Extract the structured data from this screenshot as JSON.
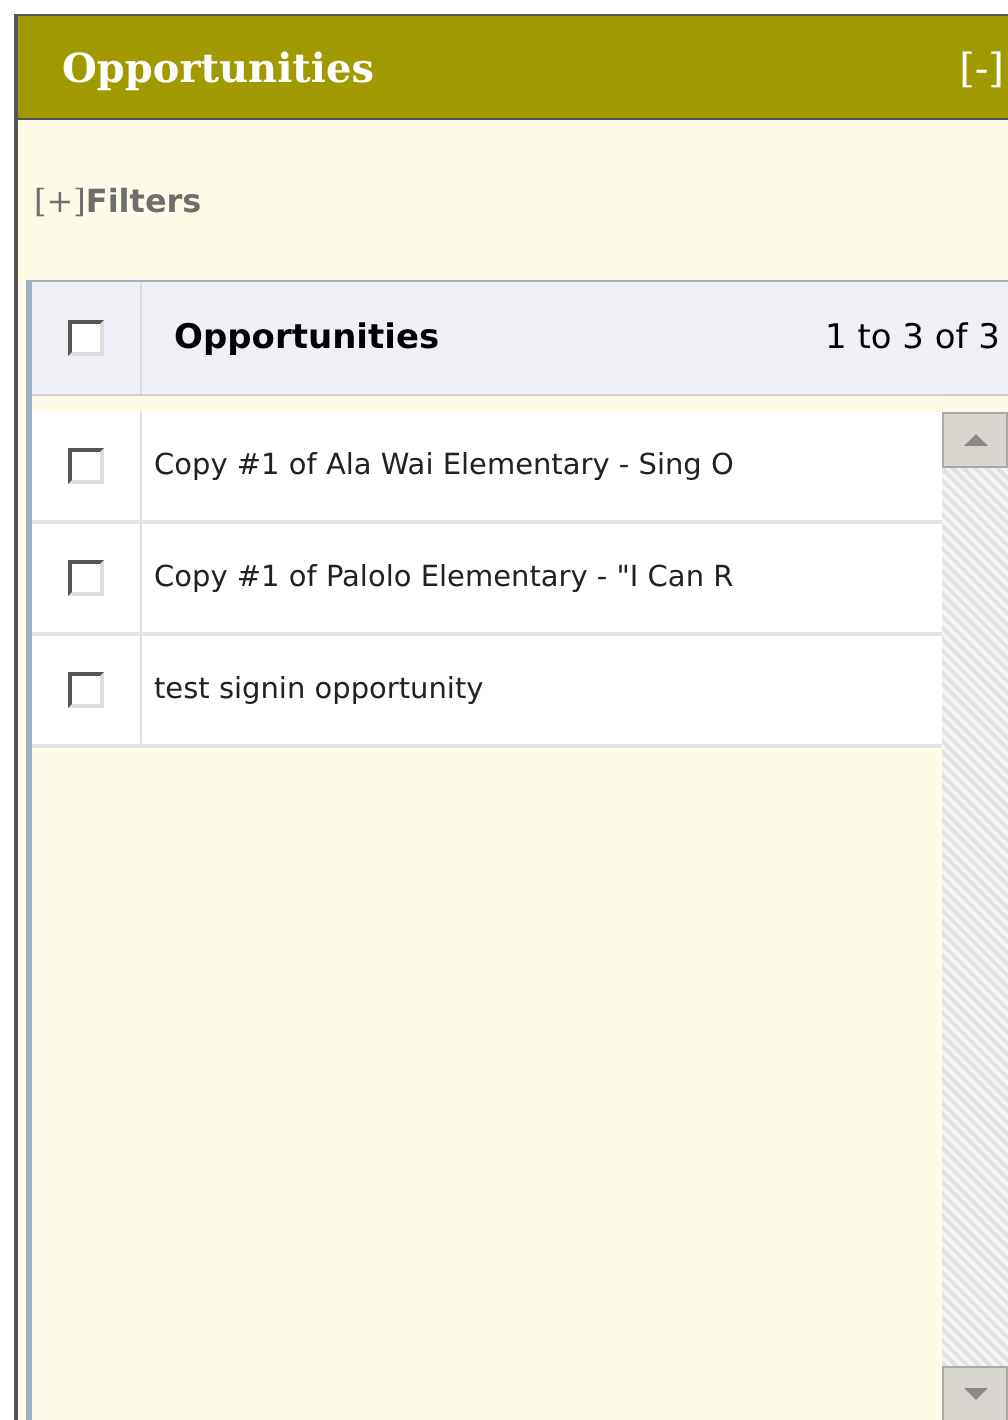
{
  "panel": {
    "title": "Opportunities",
    "collapse": "[-]"
  },
  "filters": {
    "toggle": "[+]",
    "label": "Filters"
  },
  "grid": {
    "select_all": {
      "checked": false
    },
    "column": "Opportunities",
    "count": "1 to 3 of 3",
    "rows": [
      {
        "name": "Copy #1 of Ala Wai Elementary - Sing O",
        "checked": false
      },
      {
        "name": "Copy #1 of Palolo Elementary - \"I Can R",
        "checked": false
      },
      {
        "name": "test signin opportunity",
        "checked": false
      }
    ]
  }
}
